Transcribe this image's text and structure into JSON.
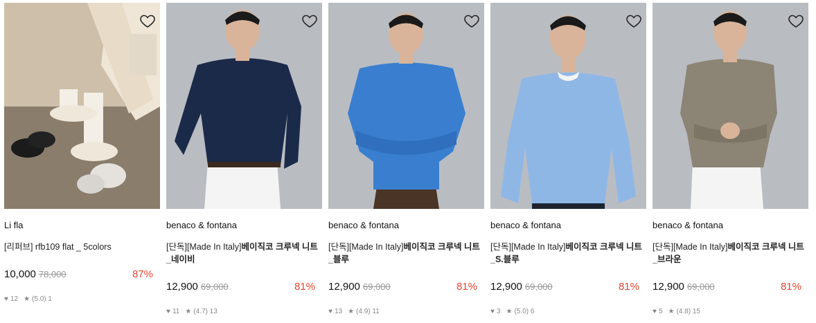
{
  "products": [
    {
      "brand": "Li fla",
      "title_prefix": "[리퍼브]",
      "title_main": " rfb109 flat _ 5colors",
      "title_main_bold": false,
      "price": "10,000",
      "original_price": "78,000",
      "discount": "87%",
      "likes": "12",
      "rating": "(5.0)",
      "reviews": "1",
      "image": "shoes-photo"
    },
    {
      "brand": "benaco & fontana",
      "title_prefix": "[단독][Made In Italy]",
      "title_main": "베이직코 크루넥 니트_네이비",
      "title_main_bold": true,
      "price": "12,900",
      "original_price": "69,000",
      "discount": "81%",
      "likes": "11",
      "rating": "(4.7)",
      "reviews": "13",
      "image": "model-navy-knit",
      "color": "#1c2a4a"
    },
    {
      "brand": "benaco & fontana",
      "title_prefix": "[단독][Made In Italy]",
      "title_main": "베이직코 크루넥 니트_블루",
      "title_main_bold": true,
      "price": "12,900",
      "original_price": "69,000",
      "discount": "81%",
      "likes": "13",
      "rating": "(4.9)",
      "reviews": "11",
      "image": "model-blue-knit",
      "color": "#3a7fcf"
    },
    {
      "brand": "benaco & fontana",
      "title_prefix": "[단독][Made In Italy]",
      "title_main": "베이직코 크루넥 니트_S.블루",
      "title_main_bold": true,
      "price": "12,900",
      "original_price": "69,000",
      "discount": "81%",
      "likes": "3",
      "rating": "(5.0)",
      "reviews": "6",
      "image": "model-skyblue-knit",
      "color": "#8fb7e6"
    },
    {
      "brand": "benaco & fontana",
      "title_prefix": "[단독][Made In Italy]",
      "title_main": "베이직코 크루넥 니트_브라운",
      "title_main_bold": true,
      "price": "12,900",
      "original_price": "69,000",
      "discount": "81%",
      "likes": "5",
      "rating": "(4.8)",
      "reviews": "15",
      "image": "model-brown-knit",
      "color": "#8c8474"
    }
  ],
  "icons": {
    "like": "heart-icon",
    "rating": "star-icon",
    "wishlist": "heart-outline-icon"
  },
  "colors": {
    "discount": "#e8452f",
    "muted": "#888888"
  }
}
